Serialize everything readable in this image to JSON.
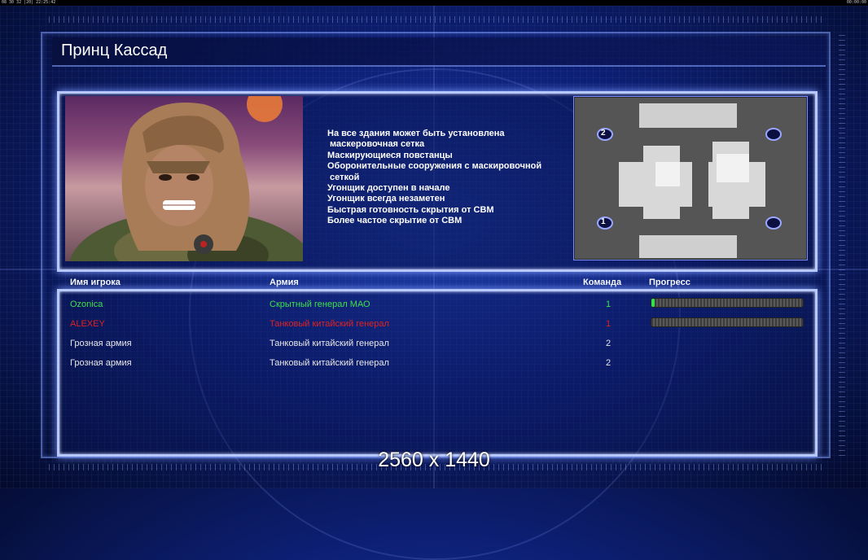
{
  "topbar": {
    "left_text": "08 30 32 |20| 22:25:42",
    "right_text": "00:00:00"
  },
  "general": {
    "name": "Принц Кассад",
    "features": [
      "На все здания может быть установлена",
      " маскеровочная сетка",
      "Маскирующиеся повстанцы",
      "Оборонительные сооружения с маскировочной",
      " сеткой",
      "Угонщик доступен в начале",
      "Угонщик всегда незаметен",
      "Быстрая готовность скрытия от СВМ",
      "Более частое скрытие от СВМ"
    ]
  },
  "minimap": {
    "start_positions": [
      "2",
      "1"
    ]
  },
  "table": {
    "headers": {
      "player": "Имя игрока",
      "army": "Армия",
      "team": "Команда",
      "progress": "Прогресс"
    },
    "rows": [
      {
        "player": "Ozonica",
        "army": "Скрытный генерал МАО",
        "team": "1",
        "progress": 0.02,
        "color": "#3fe04a"
      },
      {
        "player": "ALEXEY",
        "army": "Танковый китайский генерал",
        "team": "1",
        "progress": 0.0,
        "color": "#e02222"
      },
      {
        "player": "Грозная армия",
        "army": "Танковый китайский генерал",
        "team": "2",
        "color": "#e8e8e8"
      },
      {
        "player": "Грозная армия",
        "army": "Танковый китайский генерал",
        "team": "2",
        "color": "#e8e8e8"
      }
    ]
  },
  "watermark": "2560 x 1440"
}
